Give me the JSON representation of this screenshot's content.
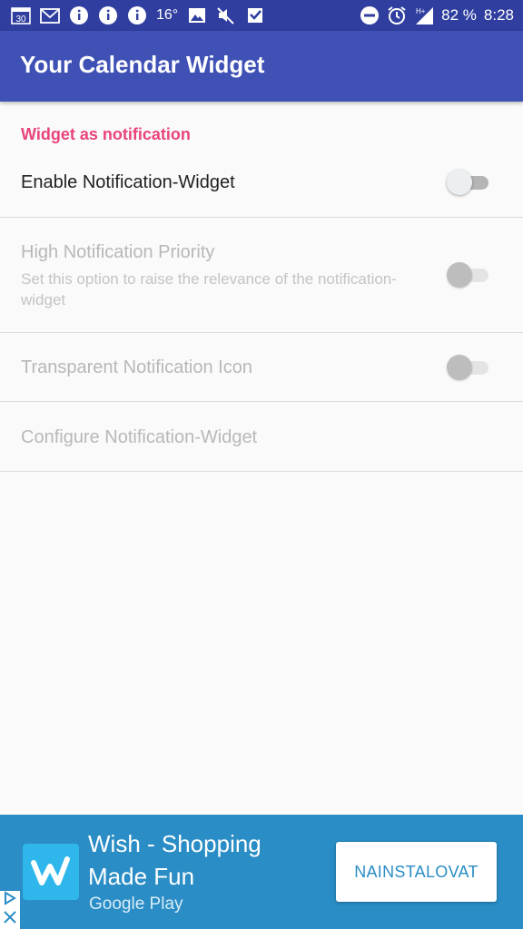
{
  "status_bar": {
    "left_icons": [
      "calendar-icon",
      "gmail-icon",
      "info-icon",
      "info-icon",
      "info-icon"
    ],
    "calendar_day": "30",
    "temperature": "16°",
    "right_icons": [
      "dnd-icon",
      "alarm-icon",
      "signal-icon"
    ],
    "network": "H+",
    "battery": "82 %",
    "time": "8:28"
  },
  "toolbar": {
    "title": "Your Calendar Widget"
  },
  "settings": {
    "category": "Widget as notification",
    "items": [
      {
        "title": "Enable Notification-Widget",
        "enabled": true,
        "checked": false
      },
      {
        "title": "High Notification Priority",
        "summary": "Set this option to raise the relevance of the notification-widget",
        "enabled": false,
        "checked": false
      },
      {
        "title": "Transparent Notification Icon",
        "enabled": false,
        "checked": false
      },
      {
        "title": "Configure Notification-Widget",
        "enabled": false
      }
    ]
  },
  "ad": {
    "title": "Wish - Shopping Made Fun",
    "store": "Google Play",
    "button_label": "NAINSTALOVAT",
    "logo_letter": "w",
    "colors": {
      "background": "#2a8dc5",
      "logo": "#2fb7ec"
    }
  },
  "colors": {
    "primary": "#3f51b5",
    "primary_dark": "#303f9f",
    "accent": "#e8447a"
  }
}
